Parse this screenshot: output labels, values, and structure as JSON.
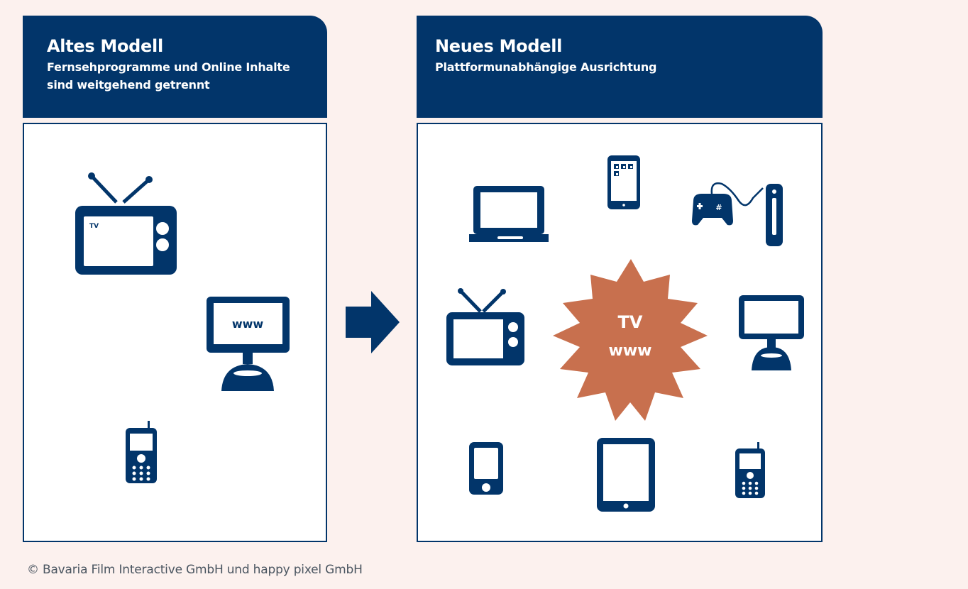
{
  "old_model": {
    "title": "Altes Modell",
    "subtitle_line1": "Fernsehprogramme und Online Inhalte",
    "subtitle_line2": "sind weitgehend getrennt",
    "tv_label": "TV",
    "www_label": "www"
  },
  "new_model": {
    "title": "Neues Modell",
    "subtitle": "Plattformunabhängige Ausrichtung",
    "burst_line1": "TV",
    "burst_line2": "www"
  },
  "footer": {
    "copyright": "© Bavaria Film Interactive GmbH und happy pixel GmbH"
  },
  "colors": {
    "navy": "#02356a",
    "burst": "#c8704e",
    "background": "#fcf1ee"
  },
  "icons": [
    "tv-icon",
    "computer-monitor-icon",
    "mobile-phone-icon",
    "laptop-icon",
    "smartphone-icon",
    "game-console-icon",
    "tablet-icon",
    "music-player-icon",
    "arrow-right-icon"
  ]
}
